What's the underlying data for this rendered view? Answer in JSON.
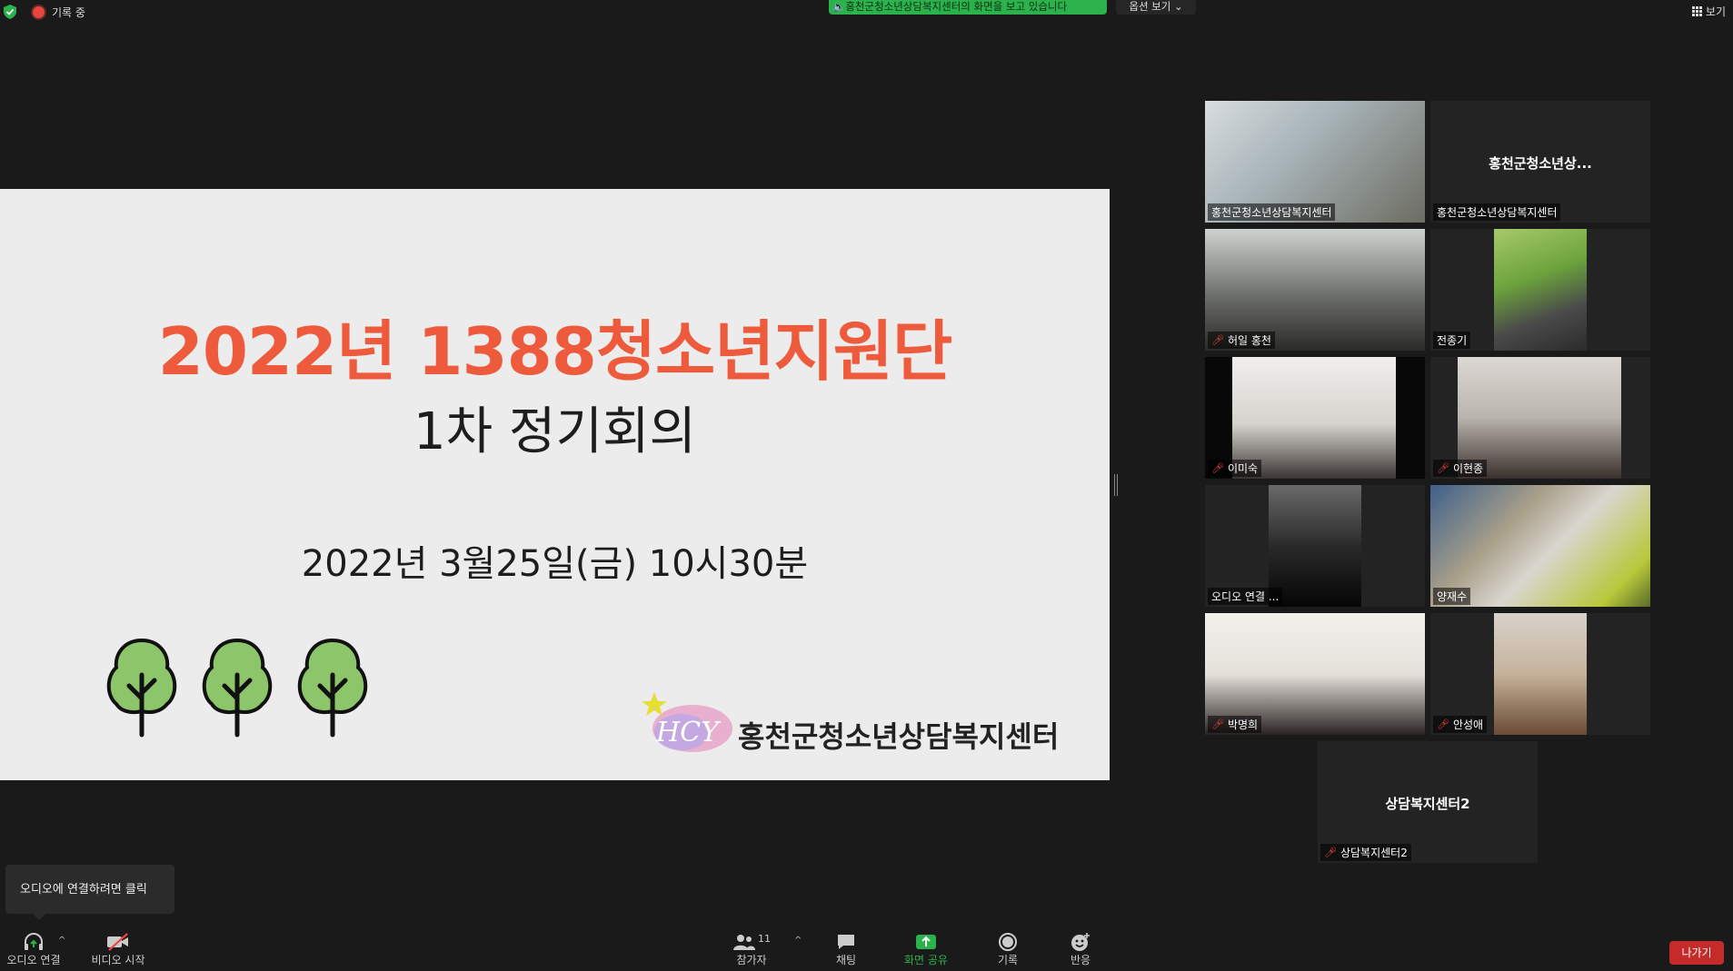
{
  "top": {
    "recording_label": "기록 중",
    "share_banner": "홍천군청소년상담복지센터의 화면을 보고 있습니다",
    "view_options": "옵션 보기 ⌄",
    "view_label": "보기"
  },
  "slide": {
    "title": "2022년 1388청소년지원단",
    "subtitle": "1차 정기회의",
    "date": "2022년 3월25일(금) 10시30분",
    "logo_text": "HCY",
    "org_name": "홍천군청소년상담복지센터",
    "colors": {
      "title": "#ee5a3c",
      "tree": "#8cc56a"
    }
  },
  "participants": [
    {
      "name": "홍천군청소년상담복지센터",
      "video": true,
      "active": true,
      "muted": false
    },
    {
      "name": "홍천군청소년상담복지센터",
      "display": "홍천군청소년상...",
      "video": false,
      "muted": false
    },
    {
      "name": "허일 홍천",
      "video": true,
      "muted": true
    },
    {
      "name": "전종기",
      "video": true,
      "muted": false
    },
    {
      "name": "이미숙",
      "video": true,
      "muted": true
    },
    {
      "name": "이현종",
      "video": true,
      "muted": true
    },
    {
      "name": "오디오 연결 ...",
      "video": true,
      "muted": false
    },
    {
      "name": "양재수",
      "video": true,
      "muted": false
    },
    {
      "name": "박명희",
      "video": true,
      "muted": true
    },
    {
      "name": "안성애",
      "video": true,
      "muted": true
    },
    {
      "name": "상담복지센터2",
      "display": "상담복지센터2",
      "video": false,
      "muted": true
    }
  ],
  "tooltip": "오디오에 연결하려면 클릭",
  "toolbar": {
    "audio": "오디오 연결",
    "video": "비디오 시작",
    "participants": "참가자",
    "participants_count": "11",
    "chat": "채팅",
    "share": "화면 공유",
    "record": "기록",
    "reactions": "반응",
    "leave": "나가기"
  }
}
